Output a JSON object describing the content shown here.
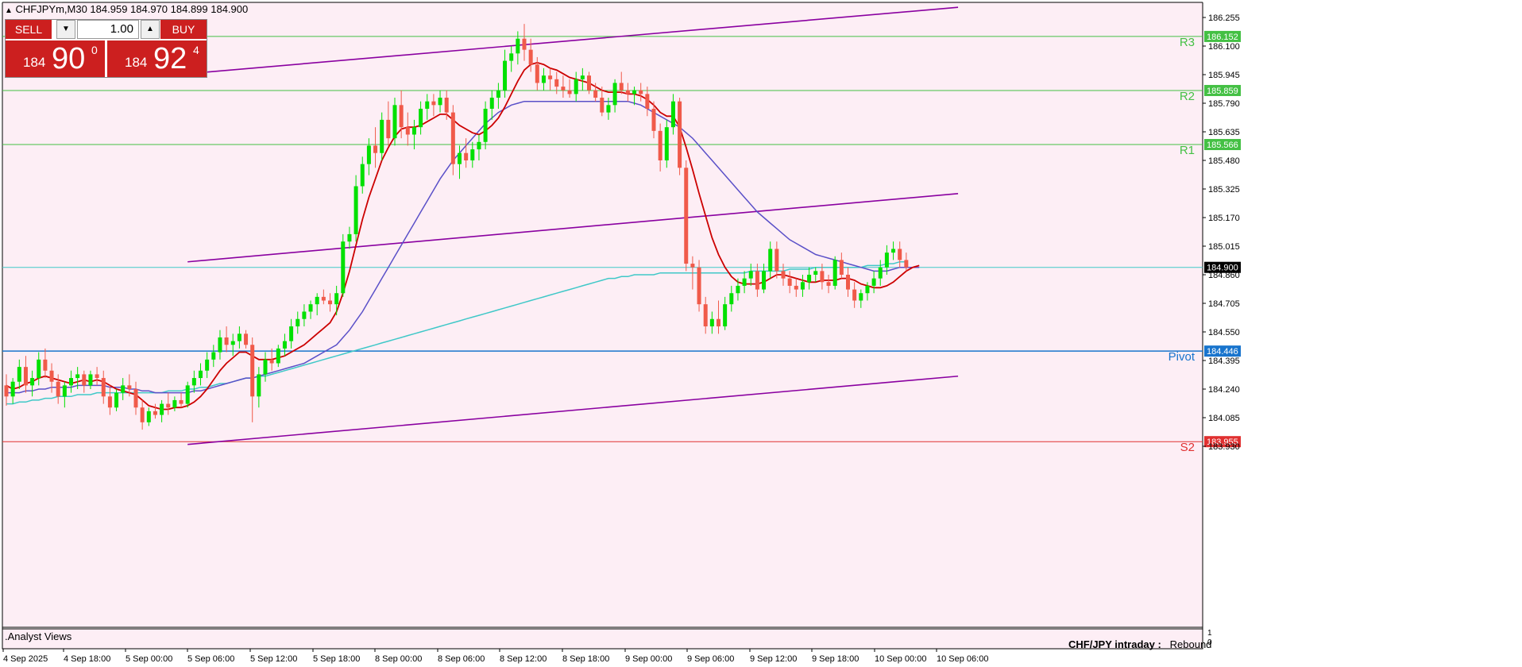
{
  "header": {
    "title": "CHFJPYm,M30  184.959 184.970 184.899 184.900"
  },
  "trade_panel": {
    "sell_label": "SELL",
    "buy_label": "BUY",
    "volume": "1.00",
    "sell_price_small": "184",
    "sell_price_big": "90",
    "sell_price_sup": "0",
    "buy_price_small": "184",
    "buy_price_big": "92",
    "buy_price_sup": "4"
  },
  "footer": {
    "analyst": ".Analyst Views",
    "caption_bold": "CHF/JPY intraday :",
    "caption_value": "Rebound"
  },
  "colors": {
    "background": "#fdeef5",
    "bull": "#00e000",
    "bear": "#f05a4a",
    "channel": "#8a00a0",
    "resistance": "#44c044",
    "pivot": "#1874cd",
    "support": "#e03030",
    "ma_fast": "#cc0000",
    "ma_mid": "#5a50c8",
    "ma_slow": "#40c8c8",
    "current": "#40c8c8"
  },
  "chart_data": {
    "type": "candlestick",
    "symbol": "CHFJPYm",
    "timeframe": "M30",
    "ylim": [
      183.9,
      186.33
    ],
    "y_ticks": [
      "186.255",
      "186.100",
      "185.945",
      "185.790",
      "185.635",
      "185.480",
      "185.325",
      "185.170",
      "185.015",
      "184.860",
      "184.705",
      "184.550",
      "184.395",
      "184.240",
      "184.085",
      "183.930"
    ],
    "x_tick_labels": [
      "4 Sep 2025",
      "4 Sep 18:00",
      "5 Sep 00:00",
      "5 Sep 06:00",
      "5 Sep 12:00",
      "5 Sep 18:00",
      "8 Sep 00:00",
      "8 Sep 06:00",
      "8 Sep 12:00",
      "8 Sep 18:00",
      "9 Sep 00:00",
      "9 Sep 06:00",
      "9 Sep 12:00",
      "9 Sep 18:00",
      "10 Sep 00:00",
      "10 Sep 06:00"
    ],
    "ohlc": [
      [
        184.26,
        184.32,
        184.15,
        184.2
      ],
      [
        184.2,
        184.3,
        184.16,
        184.28
      ],
      [
        184.28,
        184.4,
        184.24,
        184.36
      ],
      [
        184.36,
        184.42,
        184.22,
        184.26
      ],
      [
        184.26,
        184.34,
        184.2,
        184.3
      ],
      [
        184.3,
        184.44,
        184.26,
        184.4
      ],
      [
        184.4,
        184.46,
        184.3,
        184.34
      ],
      [
        184.34,
        184.38,
        184.22,
        184.28
      ],
      [
        184.28,
        184.32,
        184.16,
        184.2
      ],
      [
        184.2,
        184.28,
        184.14,
        184.26
      ],
      [
        184.26,
        184.34,
        184.22,
        184.3
      ],
      [
        184.3,
        184.36,
        184.24,
        184.32
      ],
      [
        184.32,
        184.34,
        184.22,
        184.26
      ],
      [
        184.26,
        184.34,
        184.24,
        184.32
      ],
      [
        184.32,
        184.36,
        184.26,
        184.3
      ],
      [
        184.3,
        184.34,
        184.16,
        184.2
      ],
      [
        184.2,
        184.26,
        184.1,
        184.14
      ],
      [
        184.14,
        184.24,
        184.12,
        184.22
      ],
      [
        184.22,
        184.3,
        184.18,
        184.26
      ],
      [
        184.26,
        184.32,
        184.2,
        184.24
      ],
      [
        184.24,
        184.28,
        184.1,
        184.14
      ],
      [
        184.14,
        184.18,
        184.02,
        184.06
      ],
      [
        184.06,
        184.14,
        184.04,
        184.12
      ],
      [
        184.12,
        184.16,
        184.08,
        184.1
      ],
      [
        184.1,
        184.18,
        184.06,
        184.16
      ],
      [
        184.16,
        184.22,
        184.1,
        184.14
      ],
      [
        184.14,
        184.2,
        184.12,
        184.18
      ],
      [
        184.18,
        184.22,
        184.14,
        184.16
      ],
      [
        184.16,
        184.28,
        184.14,
        184.26
      ],
      [
        184.26,
        184.34,
        184.22,
        184.3
      ],
      [
        184.3,
        184.38,
        184.26,
        184.34
      ],
      [
        184.34,
        184.44,
        184.3,
        184.4
      ],
      [
        184.4,
        184.48,
        184.36,
        184.44
      ],
      [
        184.44,
        184.56,
        184.4,
        184.52
      ],
      [
        184.52,
        184.58,
        184.44,
        184.48
      ],
      [
        184.48,
        184.54,
        184.42,
        184.5
      ],
      [
        184.5,
        184.58,
        184.46,
        184.54
      ],
      [
        184.54,
        184.56,
        184.46,
        184.48
      ],
      [
        184.48,
        184.52,
        184.06,
        184.2
      ],
      [
        184.2,
        184.36,
        184.14,
        184.32
      ],
      [
        184.32,
        184.44,
        184.28,
        184.4
      ],
      [
        184.4,
        184.46,
        184.34,
        184.38
      ],
      [
        184.38,
        184.48,
        184.36,
        184.46
      ],
      [
        184.46,
        184.54,
        184.42,
        184.5
      ],
      [
        184.5,
        184.62,
        184.46,
        184.58
      ],
      [
        184.58,
        184.66,
        184.54,
        184.62
      ],
      [
        184.62,
        184.7,
        184.58,
        184.66
      ],
      [
        184.66,
        184.72,
        184.62,
        184.7
      ],
      [
        184.7,
        184.76,
        184.64,
        184.74
      ],
      [
        184.74,
        184.78,
        184.7,
        184.72
      ],
      [
        184.72,
        184.76,
        184.66,
        184.7
      ],
      [
        184.7,
        184.8,
        184.64,
        184.76
      ],
      [
        184.76,
        185.08,
        184.74,
        185.04
      ],
      [
        185.04,
        185.12,
        185.0,
        185.08
      ],
      [
        185.08,
        185.4,
        185.04,
        185.34
      ],
      [
        185.34,
        185.5,
        185.3,
        185.46
      ],
      [
        185.46,
        185.6,
        185.4,
        185.56
      ],
      [
        185.56,
        185.66,
        185.44,
        185.52
      ],
      [
        185.52,
        185.74,
        185.48,
        185.7
      ],
      [
        185.7,
        185.8,
        185.56,
        185.6
      ],
      [
        185.6,
        185.82,
        185.56,
        185.78
      ],
      [
        185.78,
        185.86,
        185.6,
        185.66
      ],
      [
        185.66,
        185.74,
        185.56,
        185.62
      ],
      [
        185.62,
        185.7,
        185.54,
        185.66
      ],
      [
        185.66,
        185.8,
        185.62,
        185.76
      ],
      [
        185.76,
        185.84,
        185.7,
        185.8
      ],
      [
        185.8,
        185.84,
        185.72,
        185.78
      ],
      [
        185.78,
        185.86,
        185.74,
        185.82
      ],
      [
        185.82,
        185.86,
        185.7,
        185.74
      ],
      [
        185.74,
        185.78,
        185.4,
        185.46
      ],
      [
        185.46,
        185.56,
        185.38,
        185.52
      ],
      [
        185.52,
        185.6,
        185.44,
        185.48
      ],
      [
        185.48,
        185.58,
        185.44,
        185.54
      ],
      [
        185.54,
        185.62,
        185.48,
        185.58
      ],
      [
        185.58,
        185.8,
        185.54,
        185.76
      ],
      [
        185.76,
        185.86,
        185.7,
        185.82
      ],
      [
        185.82,
        185.9,
        185.76,
        185.86
      ],
      [
        185.86,
        186.08,
        185.82,
        186.02
      ],
      [
        186.02,
        186.1,
        185.96,
        186.06
      ],
      [
        186.06,
        186.18,
        186.0,
        186.14
      ],
      [
        186.14,
        186.22,
        186.02,
        186.08
      ],
      [
        186.08,
        186.14,
        185.96,
        186.0
      ],
      [
        186.0,
        186.04,
        185.86,
        185.9
      ],
      [
        185.9,
        185.98,
        185.86,
        185.94
      ],
      [
        185.94,
        185.98,
        185.86,
        185.92
      ],
      [
        185.92,
        185.96,
        185.84,
        185.88
      ],
      [
        185.88,
        185.94,
        185.82,
        185.86
      ],
      [
        185.86,
        185.92,
        185.82,
        185.84
      ],
      [
        185.84,
        185.96,
        185.8,
        185.92
      ],
      [
        185.92,
        185.98,
        185.86,
        185.94
      ],
      [
        185.94,
        185.96,
        185.84,
        185.86
      ],
      [
        185.86,
        185.9,
        185.8,
        185.82
      ],
      [
        185.82,
        185.88,
        185.72,
        185.74
      ],
      [
        185.74,
        185.82,
        185.7,
        185.78
      ],
      [
        185.78,
        185.92,
        185.74,
        185.9
      ],
      [
        185.9,
        185.96,
        185.84,
        185.86
      ],
      [
        185.86,
        185.9,
        185.8,
        185.84
      ],
      [
        185.84,
        185.88,
        185.78,
        185.86
      ],
      [
        185.86,
        185.9,
        185.8,
        185.84
      ],
      [
        185.84,
        185.88,
        185.72,
        185.76
      ],
      [
        185.76,
        185.8,
        185.6,
        185.64
      ],
      [
        185.64,
        185.68,
        185.42,
        185.48
      ],
      [
        185.48,
        185.7,
        185.44,
        185.66
      ],
      [
        185.66,
        185.84,
        185.62,
        185.8
      ],
      [
        185.8,
        185.82,
        185.4,
        185.44
      ],
      [
        185.44,
        185.48,
        184.88,
        184.92
      ],
      [
        184.92,
        184.96,
        184.78,
        184.9
      ],
      [
        184.9,
        184.94,
        184.66,
        184.7
      ],
      [
        184.7,
        184.74,
        184.54,
        184.58
      ],
      [
        184.58,
        184.66,
        184.54,
        184.62
      ],
      [
        184.62,
        184.72,
        184.54,
        184.58
      ],
      [
        184.58,
        184.74,
        184.56,
        184.7
      ],
      [
        184.7,
        184.8,
        184.66,
        184.76
      ],
      [
        184.76,
        184.84,
        184.72,
        184.8
      ],
      [
        184.8,
        184.88,
        184.76,
        184.84
      ],
      [
        184.84,
        184.92,
        184.8,
        184.88
      ],
      [
        184.88,
        184.92,
        184.74,
        184.78
      ],
      [
        184.78,
        184.92,
        184.76,
        184.88
      ],
      [
        184.88,
        185.04,
        184.84,
        185.0
      ],
      [
        185.0,
        185.04,
        184.84,
        184.88
      ],
      [
        184.88,
        184.92,
        184.8,
        184.84
      ],
      [
        184.84,
        184.88,
        184.76,
        184.8
      ],
      [
        184.8,
        184.84,
        184.74,
        184.78
      ],
      [
        184.78,
        184.86,
        184.74,
        184.82
      ],
      [
        184.82,
        184.9,
        184.78,
        184.86
      ],
      [
        184.86,
        184.9,
        184.82,
        184.88
      ],
      [
        184.88,
        184.92,
        184.78,
        184.82
      ],
      [
        184.82,
        184.86,
        184.76,
        184.8
      ],
      [
        184.8,
        184.96,
        184.78,
        184.94
      ],
      [
        184.94,
        184.98,
        184.84,
        184.86
      ],
      [
        184.86,
        184.9,
        184.74,
        184.78
      ],
      [
        184.78,
        184.82,
        184.68,
        184.72
      ],
      [
        184.72,
        184.78,
        184.68,
        184.76
      ],
      [
        184.76,
        184.82,
        184.72,
        184.8
      ],
      [
        184.8,
        184.88,
        184.76,
        184.84
      ],
      [
        184.84,
        184.94,
        184.8,
        184.9
      ],
      [
        184.9,
        185.02,
        184.86,
        184.98
      ],
      [
        184.98,
        185.04,
        184.94,
        185.0
      ],
      [
        185.0,
        185.04,
        184.9,
        184.94
      ],
      [
        184.94,
        184.98,
        184.88,
        184.9
      ]
    ],
    "ma_fast": [
      184.26,
      184.24,
      184.25,
      184.27,
      184.28,
      184.3,
      184.31,
      184.3,
      184.29,
      184.28,
      184.27,
      184.28,
      184.29,
      184.28,
      184.29,
      184.28,
      184.26,
      184.24,
      184.23,
      184.22,
      184.21,
      184.18,
      184.15,
      184.14,
      184.13,
      184.13,
      184.14,
      184.14,
      184.15,
      184.17,
      184.2,
      184.24,
      184.29,
      184.34,
      184.38,
      184.41,
      184.44,
      184.44,
      184.42,
      184.4,
      184.4,
      184.4,
      184.41,
      184.42,
      184.44,
      184.46,
      184.48,
      184.51,
      184.54,
      184.57,
      184.6,
      184.66,
      184.76,
      184.88,
      185.02,
      185.16,
      185.28,
      185.38,
      185.48,
      185.55,
      185.61,
      185.65,
      185.66,
      185.66,
      185.67,
      185.69,
      185.71,
      185.73,
      185.73,
      185.7,
      185.67,
      185.65,
      185.63,
      185.62,
      185.64,
      185.67,
      185.71,
      185.77,
      185.84,
      185.91,
      185.97,
      186.0,
      186.01,
      186.0,
      185.98,
      185.97,
      185.95,
      185.93,
      185.92,
      185.91,
      185.9,
      185.88,
      185.86,
      185.85,
      185.85,
      185.85,
      185.84,
      185.84,
      185.83,
      185.81,
      185.78,
      185.74,
      185.72,
      185.72,
      185.66,
      185.55,
      185.43,
      185.3,
      185.18,
      185.06,
      184.97,
      184.9,
      184.85,
      184.82,
      184.81,
      184.81,
      184.81,
      184.82,
      184.84,
      184.86,
      184.86,
      184.85,
      184.84,
      184.83,
      184.82,
      184.82,
      184.83,
      184.83,
      184.83,
      184.84,
      184.84,
      184.83,
      184.81,
      184.8,
      184.79,
      184.79,
      184.8,
      184.82,
      184.85,
      184.88,
      184.9,
      184.91
    ],
    "ma_mid": [
      184.22,
      184.22,
      184.22,
      184.23,
      184.23,
      184.24,
      184.24,
      184.25,
      184.25,
      184.25,
      184.25,
      184.26,
      184.26,
      184.26,
      184.26,
      184.26,
      184.25,
      184.25,
      184.25,
      184.24,
      184.24,
      184.23,
      184.23,
      184.22,
      184.22,
      184.22,
      184.22,
      184.22,
      184.22,
      184.23,
      184.23,
      184.24,
      184.25,
      184.26,
      184.27,
      184.28,
      184.29,
      184.3,
      184.3,
      184.31,
      184.32,
      184.33,
      184.34,
      184.35,
      184.36,
      184.37,
      184.38,
      184.4,
      184.42,
      184.44,
      184.46,
      184.48,
      184.52,
      184.56,
      184.61,
      184.66,
      184.72,
      184.78,
      184.84,
      184.9,
      184.96,
      185.02,
      185.08,
      185.14,
      185.2,
      185.26,
      185.32,
      185.38,
      185.43,
      185.48,
      185.52,
      185.56,
      185.6,
      185.64,
      185.68,
      185.71,
      185.74,
      185.76,
      185.78,
      185.79,
      185.8,
      185.8,
      185.8,
      185.8,
      185.8,
      185.8,
      185.8,
      185.8,
      185.8,
      185.8,
      185.8,
      185.8,
      185.8,
      185.8,
      185.8,
      185.8,
      185.8,
      185.79,
      185.78,
      185.76,
      185.74,
      185.72,
      185.7,
      185.68,
      185.66,
      185.63,
      185.6,
      185.56,
      185.52,
      185.48,
      185.44,
      185.4,
      185.36,
      185.32,
      185.28,
      185.24,
      185.2,
      185.17,
      185.14,
      185.11,
      185.08,
      185.05,
      185.03,
      185.01,
      184.99,
      184.97,
      184.96,
      184.95,
      184.94,
      184.93,
      184.92,
      184.91,
      184.9,
      184.89,
      184.88,
      184.88,
      184.88,
      184.89,
      184.9,
      184.9,
      184.9,
      184.9
    ],
    "ma_slow": [
      184.16,
      184.16,
      184.17,
      184.17,
      184.18,
      184.18,
      184.19,
      184.19,
      184.2,
      184.2,
      184.2,
      184.21,
      184.21,
      184.21,
      184.22,
      184.22,
      184.22,
      184.22,
      184.22,
      184.22,
      184.22,
      184.22,
      184.22,
      184.22,
      184.22,
      184.23,
      184.23,
      184.23,
      184.24,
      184.24,
      184.25,
      184.25,
      184.26,
      184.27,
      184.27,
      184.28,
      184.29,
      184.3,
      184.3,
      184.31,
      184.31,
      184.32,
      184.33,
      184.34,
      184.35,
      184.36,
      184.37,
      184.38,
      184.39,
      184.4,
      184.41,
      184.42,
      184.43,
      184.44,
      184.45,
      184.46,
      184.47,
      184.48,
      184.49,
      184.5,
      184.51,
      184.52,
      184.53,
      184.54,
      184.55,
      184.56,
      184.57,
      184.58,
      184.59,
      184.6,
      184.61,
      184.62,
      184.63,
      184.64,
      184.65,
      184.66,
      184.67,
      184.68,
      184.69,
      184.7,
      184.71,
      184.72,
      184.73,
      184.74,
      184.75,
      184.76,
      184.77,
      184.78,
      184.79,
      184.8,
      184.81,
      184.82,
      184.83,
      184.84,
      184.84,
      184.85,
      184.85,
      184.86,
      184.86,
      184.86,
      184.86,
      184.87,
      184.87,
      184.87,
      184.87,
      184.87,
      184.87,
      184.87,
      184.87,
      184.87,
      184.87,
      184.87,
      184.87,
      184.87,
      184.87,
      184.88,
      184.88,
      184.88,
      184.88,
      184.88,
      184.88,
      184.89,
      184.89,
      184.89,
      184.89,
      184.9,
      184.9,
      184.9,
      184.9,
      184.9,
      184.9,
      184.9,
      184.9,
      184.91,
      184.91,
      184.91,
      184.92,
      184.92,
      184.93,
      184.93
    ],
    "levels": [
      {
        "name": "R3",
        "value": 186.152,
        "label": "186.152",
        "kind": "resistance"
      },
      {
        "name": "R2",
        "value": 185.859,
        "label": "185.859",
        "kind": "resistance"
      },
      {
        "name": "R1",
        "value": 185.566,
        "label": "185.566",
        "kind": "resistance"
      },
      {
        "name": "Pivot",
        "value": 184.446,
        "label": "184.446",
        "kind": "pivot"
      },
      {
        "name": "S2",
        "value": 183.955,
        "label": "183.955",
        "kind": "support"
      }
    ],
    "current_price": {
      "value": 184.9,
      "label": "184.900"
    },
    "channel_lines": [
      {
        "from": [
          28,
          185.95
        ],
        "to": [
          147,
          186.31
        ]
      },
      {
        "from": [
          28,
          184.93
        ],
        "to": [
          147,
          185.3
        ]
      },
      {
        "from": [
          28,
          183.94
        ],
        "to": [
          147,
          184.31
        ]
      }
    ],
    "subwindow_ticks": [
      "1",
      "0"
    ]
  }
}
